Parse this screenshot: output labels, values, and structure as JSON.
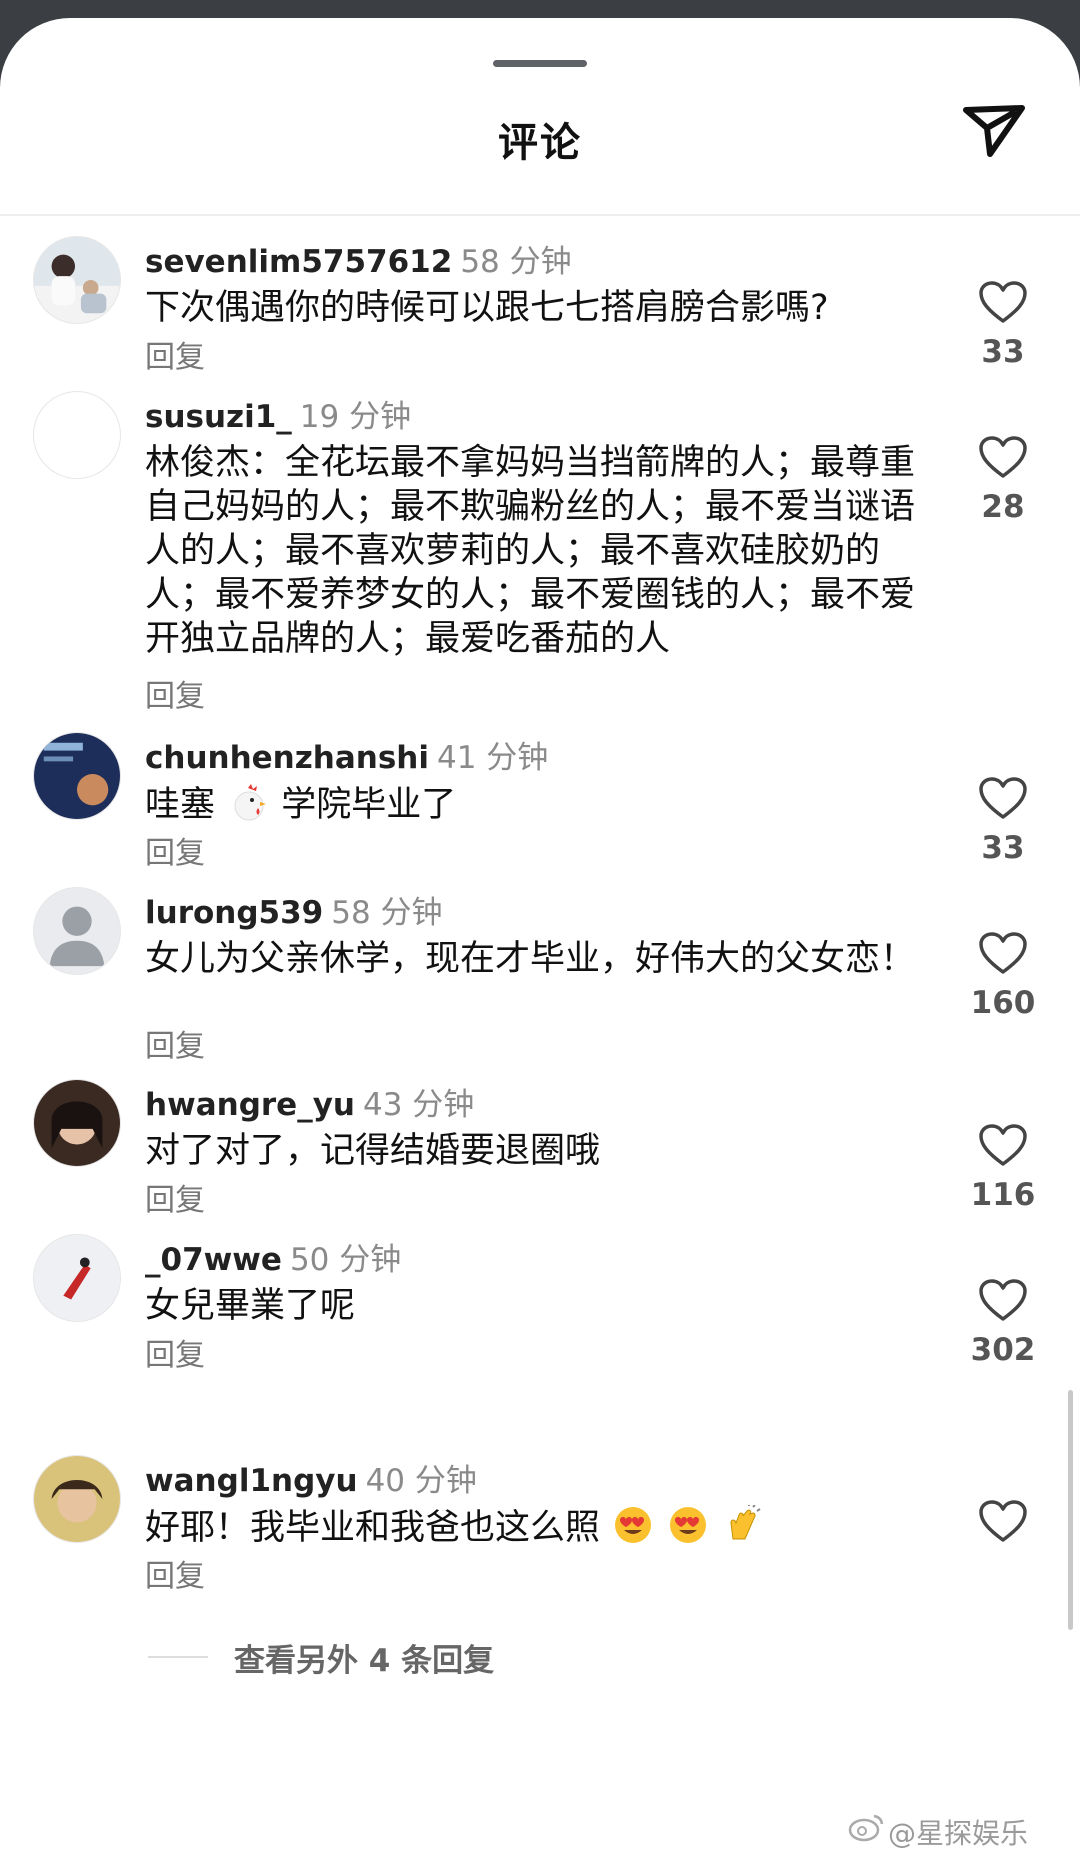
{
  "sheet": {
    "title": "评论"
  },
  "comments": [
    {
      "username": "sevenlim5757612",
      "time": "58 分钟",
      "text": "下次偶遇你的時候可以跟七七搭肩膀合影嗎?",
      "reply_label": "回复",
      "likes": "33"
    },
    {
      "username": "susuzi1_",
      "time": "19 分钟",
      "text": "林俊杰：全花坛最不拿妈妈当挡箭牌的人；最尊重自己妈妈的人；最不欺骗粉丝的人；最不爱当谜语人的人；最不喜欢萝莉的人；最不喜欢硅胶奶的人；最不爱养梦女的人；最不爱圈钱的人；最不爱开独立品牌的人；最爱吃番茄的人",
      "reply_label": "回复",
      "likes": "28"
    },
    {
      "username": "chunhenzhanshi",
      "time": "41 分钟",
      "text_before": "哇塞",
      "text_after": "学院毕业了",
      "reply_label": "回复",
      "likes": "33"
    },
    {
      "username": "lurong539",
      "time": "58 分钟",
      "text": "女儿为父亲休学，现在才毕业，好伟大的父女恋！",
      "reply_label": "回复",
      "likes": "160"
    },
    {
      "username": "hwangre_yu",
      "time": "43 分钟",
      "text": "对了对了，记得结婚要退圈哦",
      "reply_label": "回复",
      "likes": "116"
    },
    {
      "username": "_07wwe",
      "time": "50 分钟",
      "text": "女兒畢業了呢",
      "reply_label": "回复",
      "likes": "302"
    },
    {
      "username": "wangl1ngyu",
      "time": "40 分钟",
      "text": "好耶！我毕业和我爸也这么照",
      "reply_label": "回复"
    }
  ],
  "more_replies": "查看另外 4 条回复",
  "watermark": "@星探娱乐",
  "icons": {
    "send": "send-paper-plane-icon",
    "like": "heart-outline-icon",
    "chicken": "chicken-emoji",
    "heart_eyes": "heart-eyes-emoji",
    "clap": "clapping-hands-emoji"
  }
}
